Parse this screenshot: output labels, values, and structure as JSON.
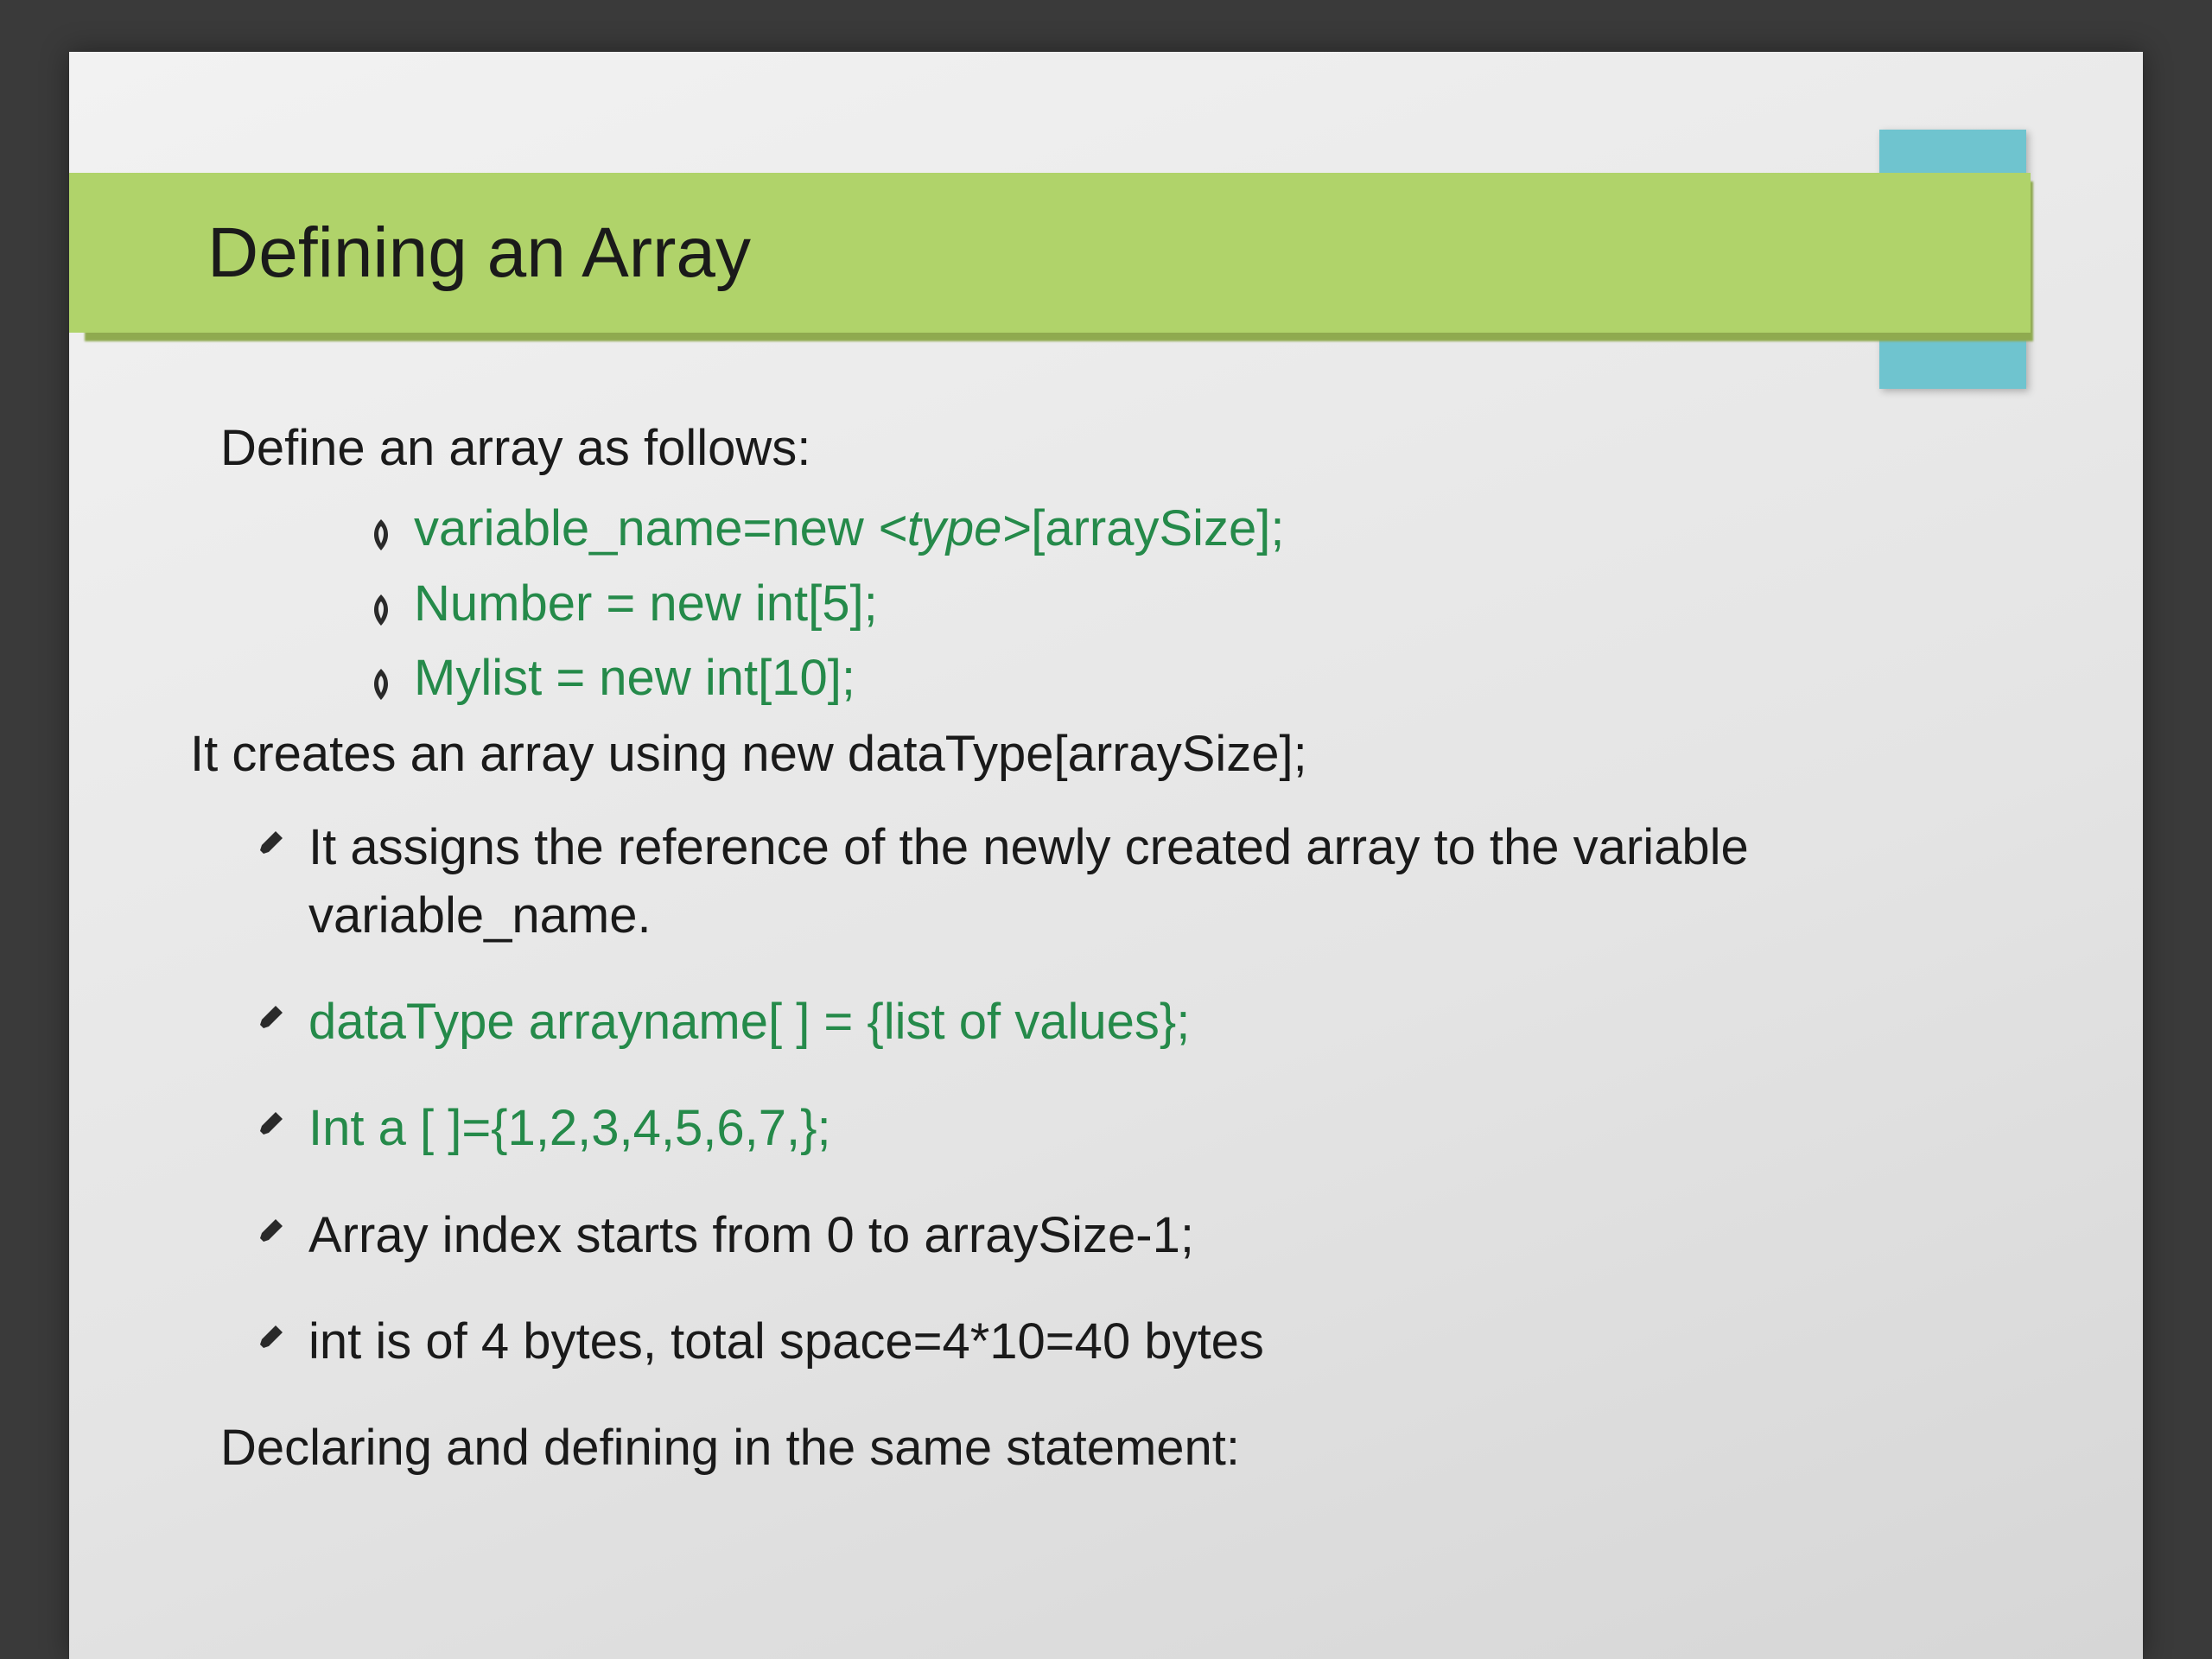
{
  "slide": {
    "title": "Defining an Array",
    "intro": "Define an array as follows:",
    "ribbon_items": [
      {
        "pre": "variable_name=new ",
        "italic": "<type>",
        "post": "[arraySize];"
      },
      {
        "pre": "Number = new int[5];",
        "italic": "",
        "post": ""
      },
      {
        "pre": "Mylist = new int[10];",
        "italic": "",
        "post": ""
      }
    ],
    "after_ribbon": "It creates an array using new dataType[arraySize];",
    "bullets": [
      {
        "text": "It assigns the reference of the newly created array to the variable variable_name.",
        "green": false
      },
      {
        "text": "dataType arrayname[ ] = {list of values};",
        "green": true
      },
      {
        "text": "Int a [ ]={1,2,3,4,5,6,7,};",
        "green": true
      },
      {
        "text": "Array index starts from 0 to arraySize-1;",
        "green": false
      },
      {
        "text": "int is of 4 bytes, total space=4*10=40 bytes",
        "green": false
      }
    ],
    "last_line": "Declaring and defining in the same statement:"
  }
}
